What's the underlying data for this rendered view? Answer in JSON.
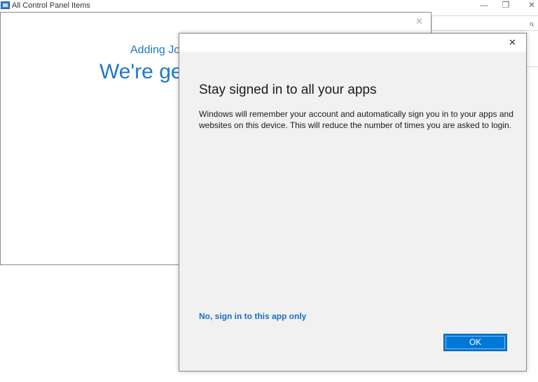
{
  "window": {
    "title": "All Control Panel Items",
    "minimize_glyph": "—",
    "restore_glyph": "❐",
    "close_glyph": "✕"
  },
  "search": {
    "icon": "search-icon",
    "glyph": "⌕"
  },
  "adding_window": {
    "subtitle": "Adding Jo",
    "heading": "We're get",
    "close_glyph": "✕"
  },
  "dialog": {
    "close_glyph": "✕",
    "title": "Stay signed in to all your apps",
    "body": "Windows will remember your account and automatically sign you in to your apps and websites on this device. This will reduce the number of times you are asked to login.",
    "link": "No, sign in to this app only",
    "ok_label": "OK"
  },
  "colors": {
    "accent": "#0078d7",
    "link": "#1a6fc7",
    "heading_blue": "#1e78c8"
  }
}
